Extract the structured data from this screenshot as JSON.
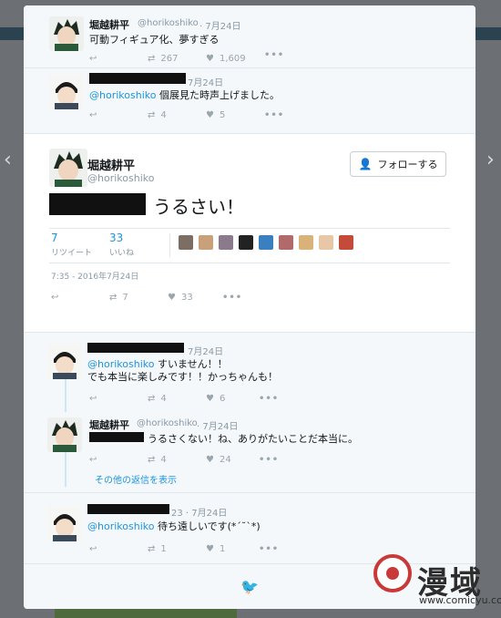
{
  "tweets": {
    "t1": {
      "name": "堀越耕平",
      "handle": "@horikoshiko",
      "time": "· 7月24日",
      "text": "可動フィギュア化、夢すぎる",
      "retweets": "267",
      "likes": "1,609"
    },
    "t2": {
      "time": "7月24日",
      "mention": "@horikoshiko",
      "text": "個展見た時声上げました。",
      "retweets": "4",
      "likes": "5"
    },
    "main": {
      "name": "堀越耕平",
      "handle": "@horikoshiko",
      "follow_label": "フォローする",
      "text": "うるさい！",
      "retweet_count": "7",
      "retweet_label": "リツイート",
      "like_count": "33",
      "like_label": "いいね",
      "timestamp": "7:35 - 2016年7月24日",
      "action_retweets": "7",
      "action_likes": "33"
    },
    "r1": {
      "time": "7月24日",
      "mention": "@horikoshiko",
      "line1": "すいません！！",
      "line2": "でも本当に楽しみです！！かっちゃんも！",
      "retweets": "4",
      "likes": "6"
    },
    "r2": {
      "name": "堀越耕平",
      "handle": "@horikoshiko",
      "time": "· 7月24日",
      "text": "うるさくない！ね、ありがたいことだ本当に。",
      "retweets": "4",
      "likes": "24"
    },
    "show_more": "その他の返信を表示",
    "r3": {
      "time": "23 · 7月24日",
      "mention": "@horikoshiko",
      "text": "待ち遠しいです(*´˘`*)",
      "retweets": "1",
      "likes": "1"
    }
  },
  "watermark": {
    "text": "漫域",
    "url": "www.comicyu.com"
  },
  "colors": {
    "link": "#1b95e0",
    "meta": "#8899a6",
    "redaction": "#111111",
    "watermark_red": "#c83a3a"
  },
  "icons": [
    "reply-icon",
    "retweet-icon",
    "heart-icon",
    "more-icon",
    "add-user-icon",
    "twitter-bird-icon"
  ]
}
